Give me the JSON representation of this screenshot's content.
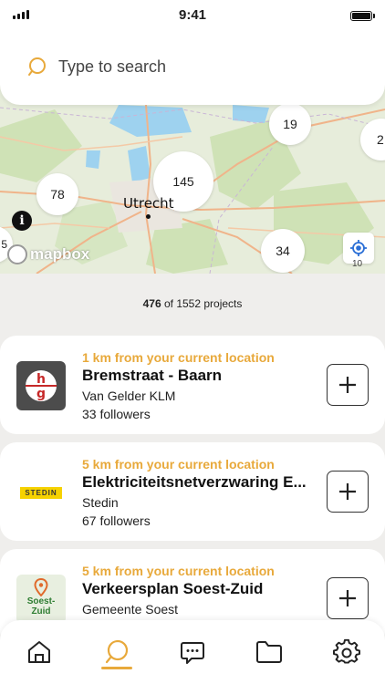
{
  "status_bar": {
    "time": "9:41"
  },
  "search": {
    "placeholder": "Type to search"
  },
  "map": {
    "clusters": [
      "19",
      "145",
      "78",
      "34"
    ],
    "edge_counts": [
      "2",
      "5",
      "10"
    ],
    "city": "Utrecht",
    "attribution": "mapbox"
  },
  "results": {
    "shown": "476",
    "of_text": " of 1552 projects"
  },
  "projects": [
    {
      "distance": "1 km from your current location",
      "title": "Bremstraat - Baarn",
      "owner": "Van Gelder KLM",
      "followers": "33 followers",
      "logo_text": "hg"
    },
    {
      "distance": "5 km from your current location",
      "title": "Elektriciteitsnetverzwaring E...",
      "owner": "Stedin",
      "followers": "67 followers",
      "logo_text": "STEDIN"
    },
    {
      "distance": "5 km from your current location",
      "title": "Verkeersplan Soest-Zuid",
      "owner": "Gemeente Soest",
      "followers": "",
      "logo_text": "Soest-Zuid"
    }
  ],
  "colors": {
    "accent": "#e8a93b"
  },
  "nav": {
    "items": [
      "home-icon",
      "search-icon",
      "chat-icon",
      "folder-icon",
      "settings-icon"
    ],
    "active": "search-icon"
  }
}
